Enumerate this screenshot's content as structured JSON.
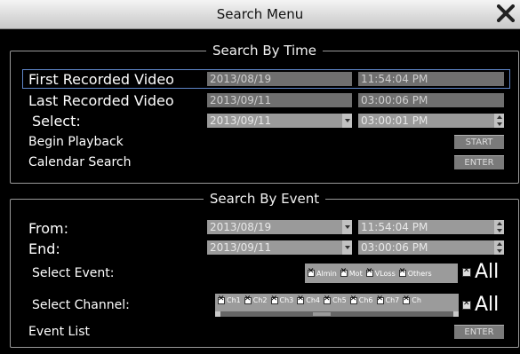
{
  "window": {
    "title": "Search Menu"
  },
  "search_by_time": {
    "legend": "Search By Time",
    "first_recorded_label": "First Recorded Video",
    "first_recorded_date": "2013/08/19",
    "first_recorded_time": "11:54:04 PM",
    "last_recorded_label": "Last Recorded Video",
    "last_recorded_date": "2013/09/11",
    "last_recorded_time": "03:00:06 PM",
    "select_label": "Select:",
    "select_date": "2013/09/11",
    "select_time": "03:00:01 PM",
    "begin_playback_label": "Begin Playback",
    "start_button": "START",
    "calendar_search_label": "Calendar Search",
    "calendar_enter_button": "ENTER"
  },
  "search_by_event": {
    "legend": "Search By Event",
    "from_label": "From:",
    "from_date": "2013/08/19",
    "from_time": "11:54:04 PM",
    "end_label": "End:",
    "end_date": "2013/09/11",
    "end_time": "03:00:06 PM",
    "select_event_label": "Select Event:",
    "events": [
      "Almin",
      "Mot",
      "VLoss",
      "Others"
    ],
    "all_label": "All",
    "select_channel_label": "Select Channel:",
    "channels": [
      "Ch1",
      "Ch2",
      "Ch3",
      "Ch4",
      "Ch5",
      "Ch6",
      "Ch7",
      "Ch"
    ],
    "channel_all_label": "All",
    "event_list_label": "Event List",
    "event_list_button": "ENTER"
  }
}
